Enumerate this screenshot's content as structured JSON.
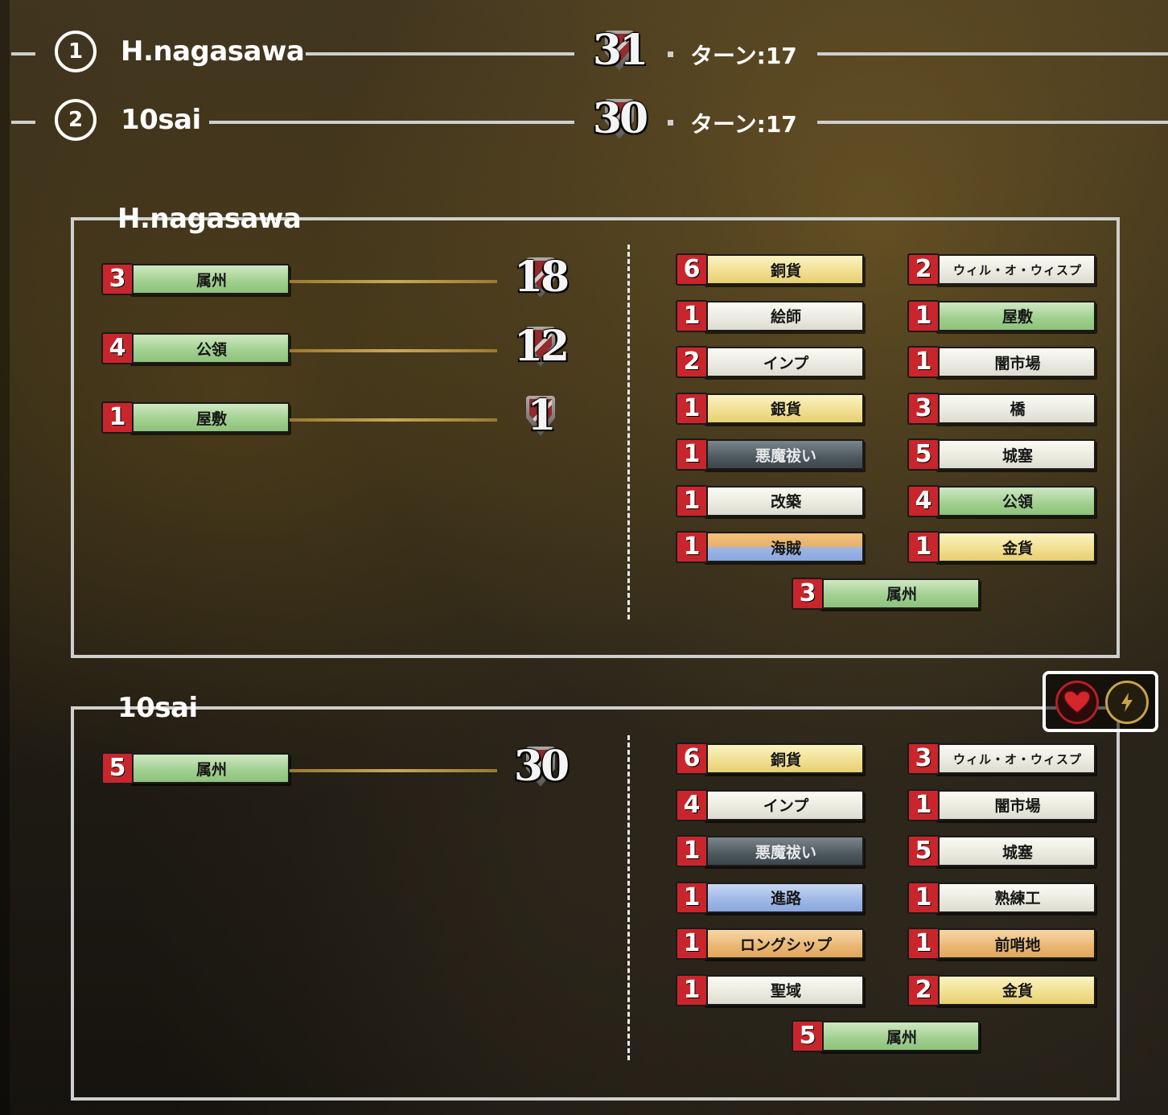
{
  "ranking": [
    {
      "rank": "1",
      "name": "H.nagasawa",
      "score": "31",
      "turn_label": "ターン:",
      "turn": "17"
    },
    {
      "rank": "2",
      "name": "10sai",
      "score": "30",
      "turn_label": "ターン:",
      "turn": "17"
    }
  ],
  "players": [
    {
      "name": "H.nagasawa",
      "vp_cards": [
        {
          "count": "3",
          "label": "属州",
          "color": "green",
          "points": "18"
        },
        {
          "count": "4",
          "label": "公領",
          "color": "green",
          "points": "12"
        },
        {
          "count": "1",
          "label": "屋敷",
          "color": "green",
          "points": "1"
        }
      ],
      "deck_left": [
        {
          "count": "6",
          "label": "銅貨",
          "color": "yellow"
        },
        {
          "count": "1",
          "label": "絵師",
          "color": "white"
        },
        {
          "count": "2",
          "label": "インプ",
          "color": "white"
        },
        {
          "count": "1",
          "label": "銀貨",
          "color": "yellow"
        },
        {
          "count": "1",
          "label": "悪魔祓い",
          "color": "dark"
        },
        {
          "count": "1",
          "label": "改築",
          "color": "white"
        },
        {
          "count": "1",
          "label": "海賊",
          "color": "oceanic"
        }
      ],
      "deck_right": [
        {
          "count": "2",
          "label": "ウィル・オ・ウィスプ",
          "color": "white"
        },
        {
          "count": "1",
          "label": "屋敷",
          "color": "green"
        },
        {
          "count": "1",
          "label": "闇市場",
          "color": "white"
        },
        {
          "count": "3",
          "label": "橋",
          "color": "white"
        },
        {
          "count": "5",
          "label": "城塞",
          "color": "white"
        },
        {
          "count": "4",
          "label": "公領",
          "color": "green"
        },
        {
          "count": "1",
          "label": "金貨",
          "color": "yellow"
        }
      ],
      "deck_bottom": {
        "count": "3",
        "label": "属州",
        "color": "green"
      }
    },
    {
      "name": "10sai",
      "vp_cards": [
        {
          "count": "5",
          "label": "属州",
          "color": "green",
          "points": "30"
        }
      ],
      "deck_left": [
        {
          "count": "6",
          "label": "銅貨",
          "color": "yellow"
        },
        {
          "count": "4",
          "label": "インプ",
          "color": "white"
        },
        {
          "count": "1",
          "label": "悪魔祓い",
          "color": "dark"
        },
        {
          "count": "1",
          "label": "進路",
          "color": "blue"
        },
        {
          "count": "1",
          "label": "ロングシップ",
          "color": "orange"
        },
        {
          "count": "1",
          "label": "聖域",
          "color": "white"
        }
      ],
      "deck_right": [
        {
          "count": "3",
          "label": "ウィル・オ・ウィスプ",
          "color": "white"
        },
        {
          "count": "1",
          "label": "闇市場",
          "color": "white"
        },
        {
          "count": "5",
          "label": "城塞",
          "color": "white"
        },
        {
          "count": "1",
          "label": "熟練工",
          "color": "white"
        },
        {
          "count": "1",
          "label": "前哨地",
          "color": "orange"
        },
        {
          "count": "2",
          "label": "金貨",
          "color": "yellow"
        }
      ],
      "deck_bottom": {
        "count": "5",
        "label": "属州",
        "color": "green"
      }
    }
  ],
  "icons": {
    "heart": "heart-icon",
    "bolt": "lightning-icon",
    "heart_color": "#d4262c",
    "bolt_color": "#c9a34a"
  }
}
